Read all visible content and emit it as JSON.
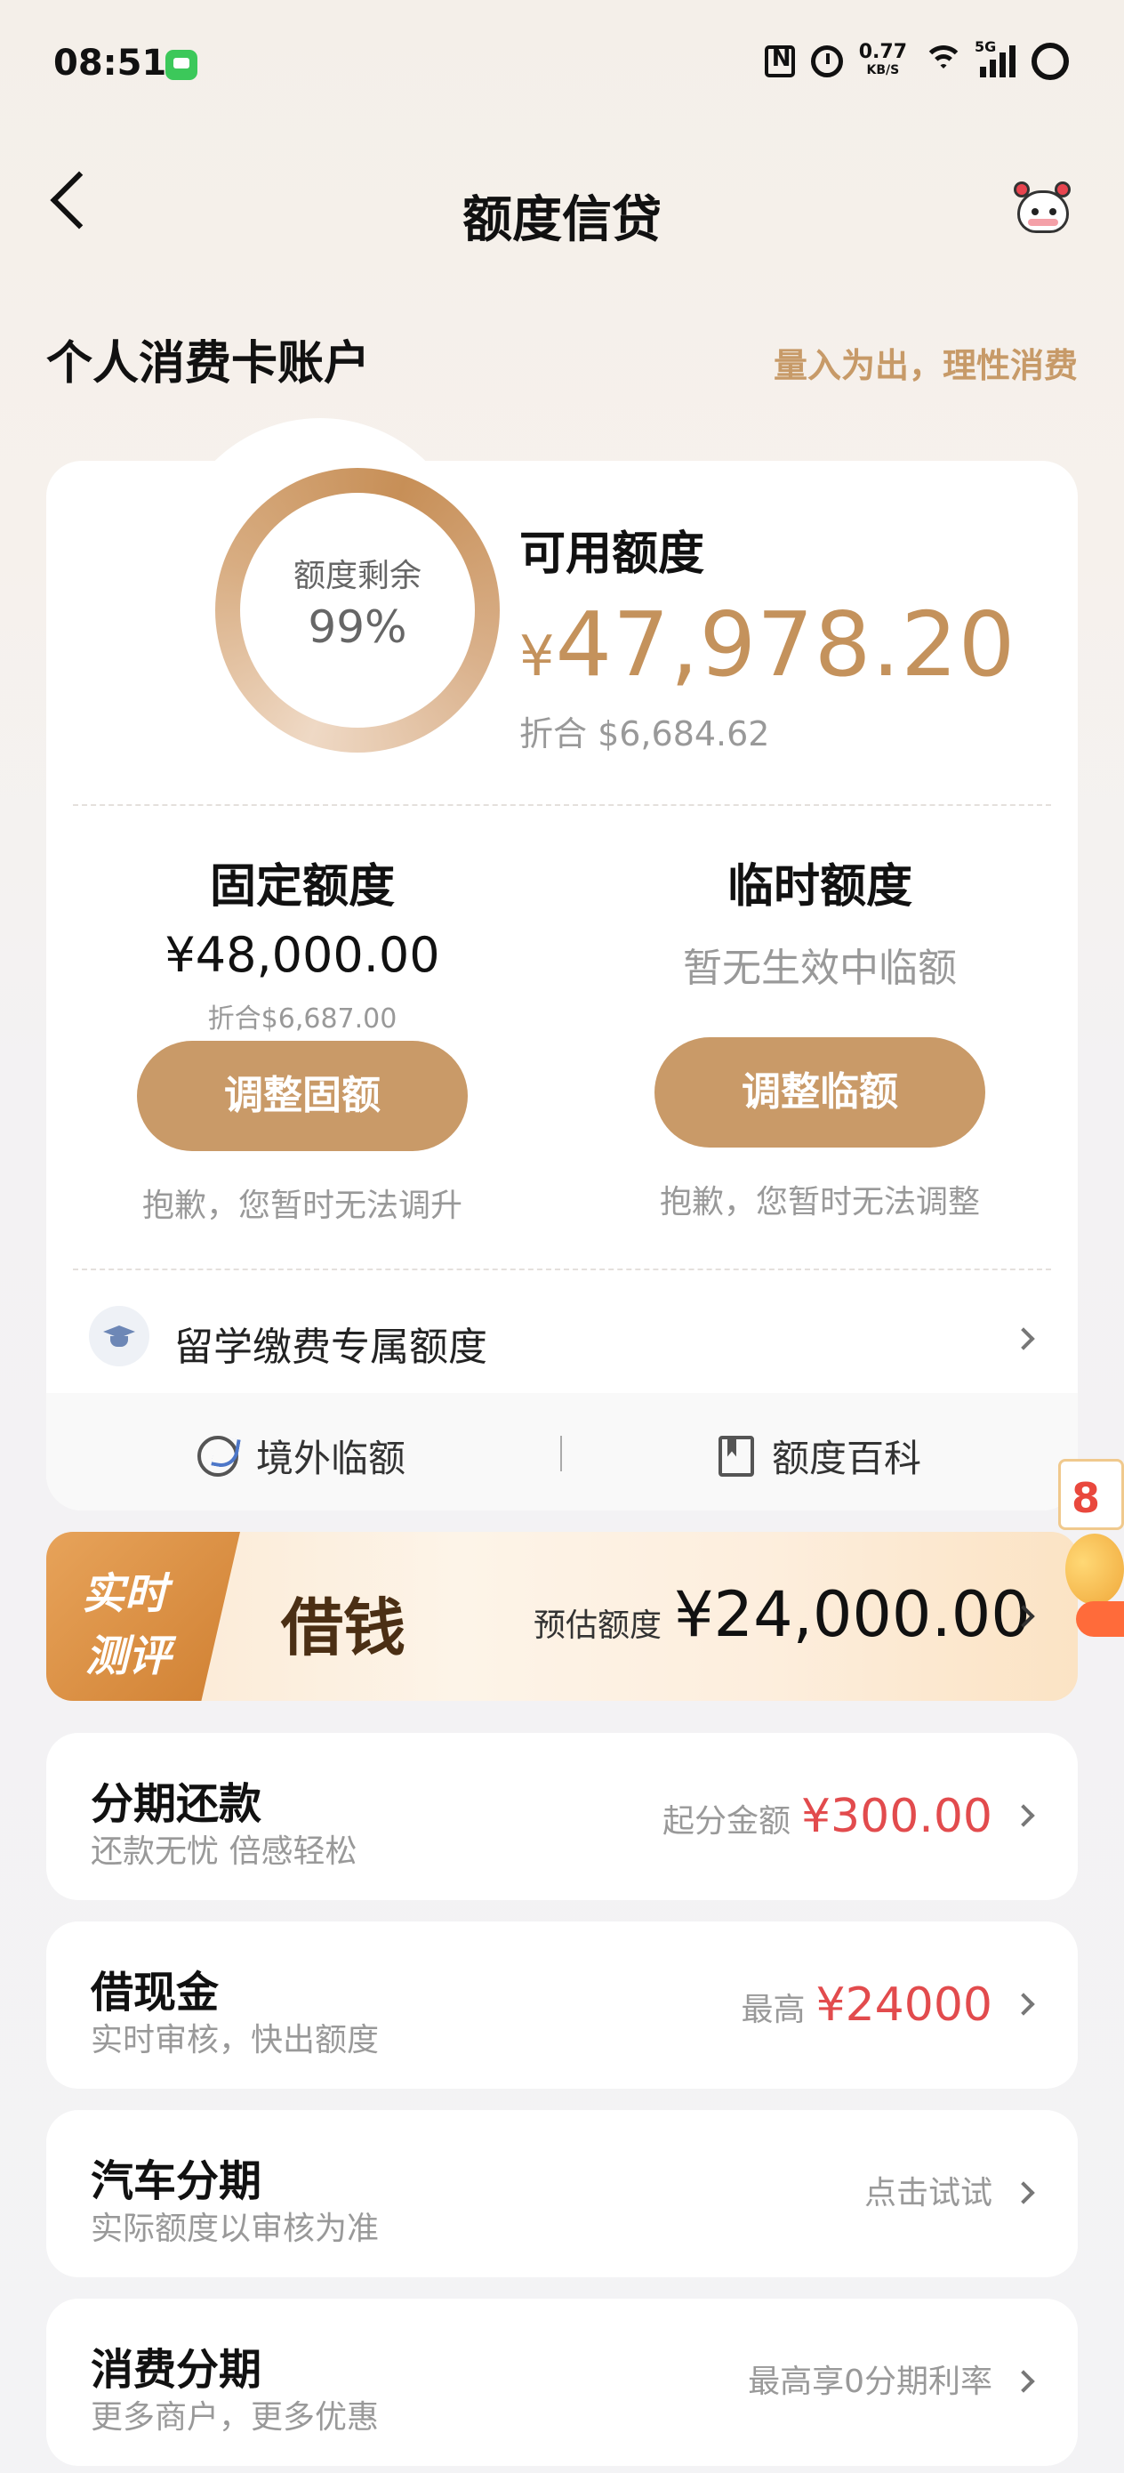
{
  "status_bar": {
    "time": "08:51",
    "net_speed": "0.77",
    "net_speed_unit": "KB/S",
    "signal_label": "5G"
  },
  "nav": {
    "title": "额度信贷"
  },
  "account": {
    "title": "个人消费卡账户",
    "slogan": "量入为出，理性消费"
  },
  "credit": {
    "ring_label": "额度剩余",
    "ring_value": "99%",
    "remaining_fraction": 0.99,
    "available_label": "可用额度",
    "available_symbol": "¥",
    "available_amount": "47,978.20",
    "available_converted": "折合  $6,684.62",
    "fixed": {
      "title": "固定额度",
      "amount": "¥48,000.00",
      "converted": "折合$6,687.00",
      "button": "调整固额",
      "note": "抱歉，您暂时无法调升"
    },
    "temp": {
      "title": "临时额度",
      "status": "暂无生效中临额",
      "button": "调整临额",
      "note": "抱歉，您暂时无法调整"
    },
    "study_abroad": "留学缴费专属额度",
    "footer": {
      "overseas": "境外临额",
      "wiki": "额度百科"
    }
  },
  "banner": {
    "tag_line1": "实时",
    "tag_line2": "测评",
    "title": "借钱",
    "estimate_label": "预估额度",
    "estimate_amount": "¥24,000.00",
    "badge": "8"
  },
  "services": [
    {
      "title": "分期还款",
      "subtitle": "还款无忧 倍感轻松",
      "label": "起分金额",
      "value": "¥300.00"
    },
    {
      "title": "借现金",
      "subtitle": "实时审核，快出额度",
      "label": "最高",
      "value": "¥24000"
    },
    {
      "title": "汽车分期",
      "subtitle": "实际额度以审核为准",
      "label": "点击试试",
      "value": ""
    },
    {
      "title": "消费分期",
      "subtitle": "更多商户，更多优惠",
      "label": "最高享0分期利率",
      "value": ""
    }
  ],
  "colors": {
    "accent_gold": "#c99a68",
    "amount_gold": "#c4925c",
    "price_red": "#e24b4d"
  },
  "icons": [
    "back-arrow-icon",
    "mascot-icon",
    "graduation-cap-icon",
    "globe-icon",
    "book-icon",
    "chevron-right-icon"
  ]
}
